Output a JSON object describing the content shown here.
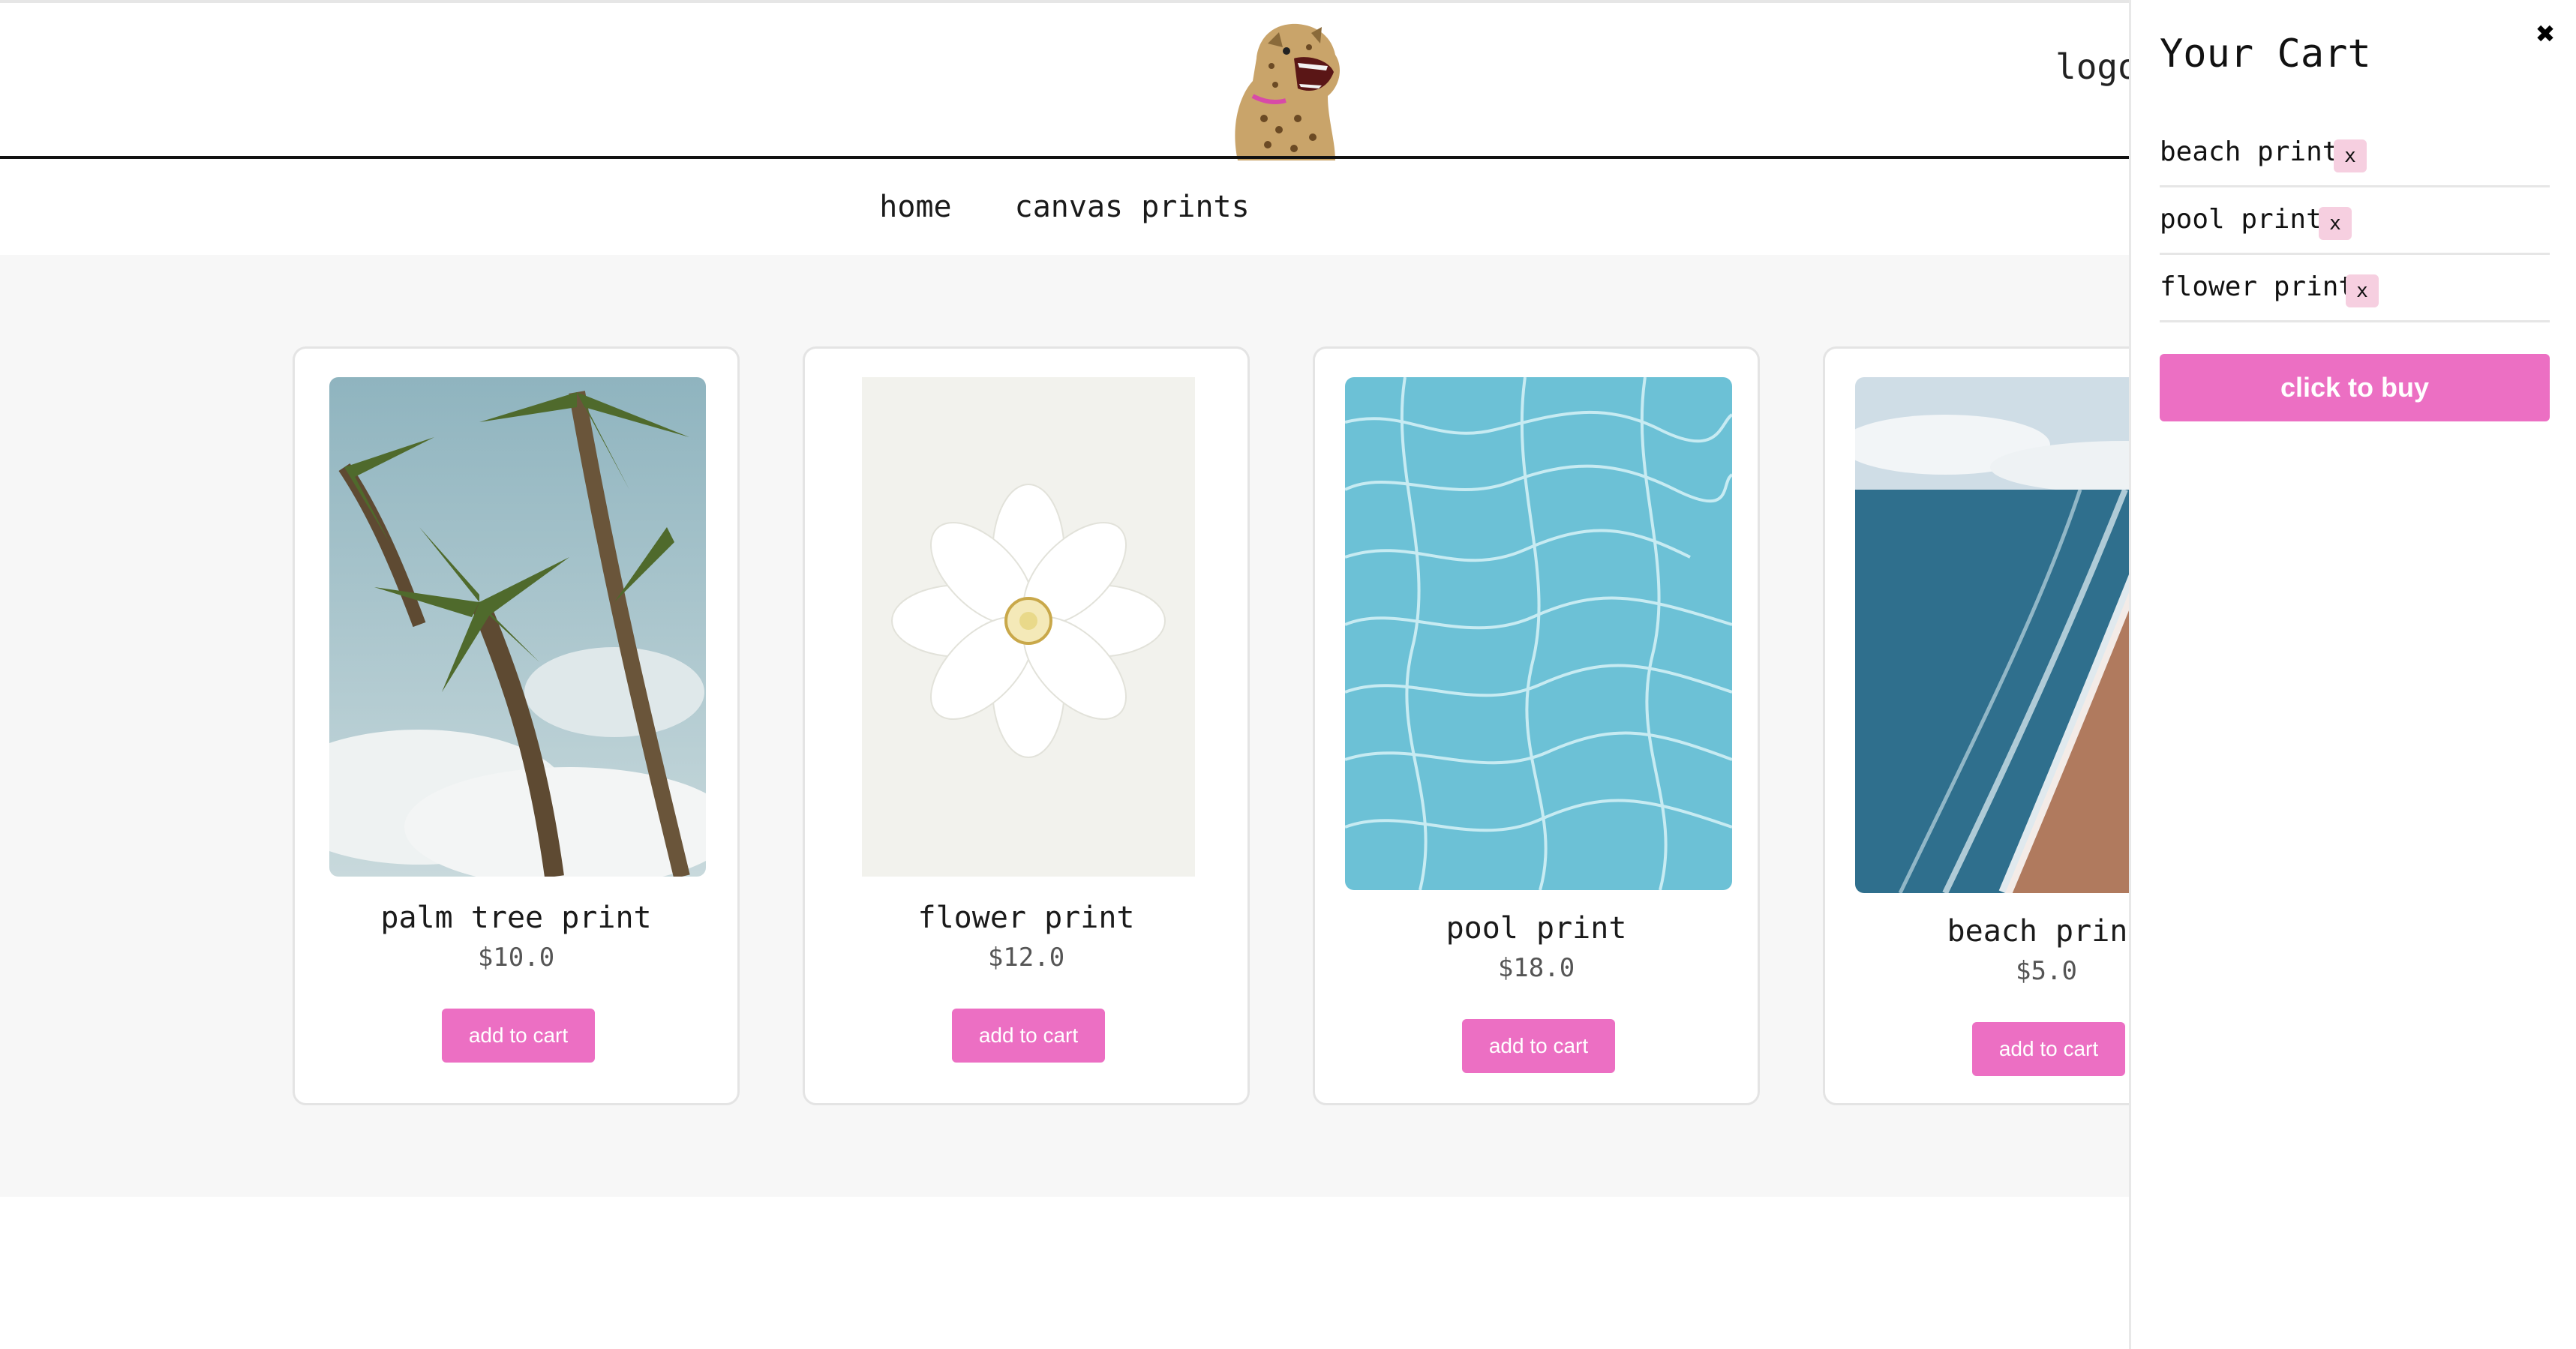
{
  "header": {
    "logo_text": "logo"
  },
  "nav": {
    "items": [
      {
        "label": "home"
      },
      {
        "label": "canvas prints"
      }
    ]
  },
  "products": [
    {
      "title": "palm tree print",
      "price": "$10.0",
      "button": "add to cart"
    },
    {
      "title": "flower print",
      "price": "$12.0",
      "button": "add to cart"
    },
    {
      "title": "pool print",
      "price": "$18.0",
      "button": "add to cart"
    },
    {
      "title": "beach print",
      "price": "$5.0",
      "button": "add to cart"
    }
  ],
  "cart": {
    "title": "Your Cart",
    "close_icon": "✖",
    "items": [
      {
        "name": "beach print",
        "remove": "x"
      },
      {
        "name": "pool print",
        "remove": "x"
      },
      {
        "name": "flower print",
        "remove": "x"
      }
    ],
    "buy_label": "click to buy"
  },
  "colors": {
    "accent": "#ec6fc3",
    "remove_bg": "#f6cfe0",
    "shop_bg": "#f7f7f7"
  },
  "icons": {
    "logo": "leopard-logo-icon",
    "close": "close-icon"
  }
}
